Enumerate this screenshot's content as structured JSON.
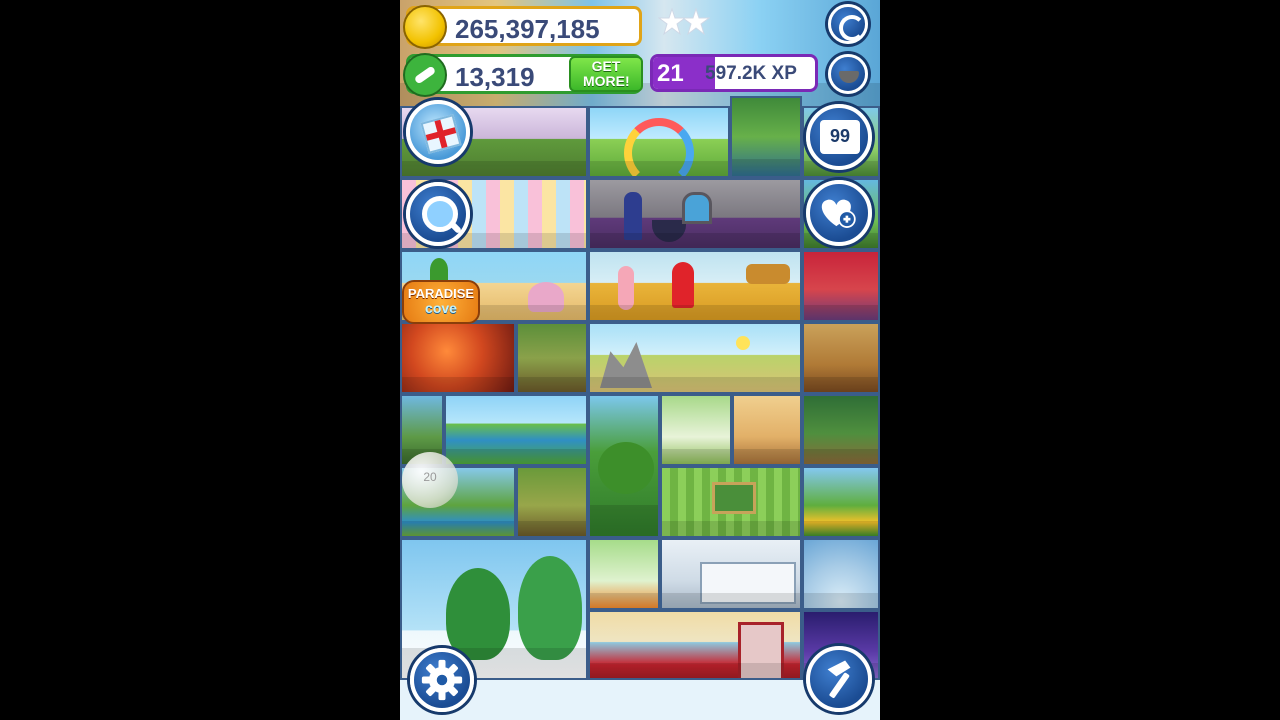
{
  "hud": {
    "coins": "265,397,185",
    "bones": "13,319",
    "get_more_label": "GET MORE!",
    "level": "21",
    "xp": "597.2K XP",
    "pet_book_count": "99",
    "paradise_cove_line1": "PARADISE",
    "paradise_cove_line2": "cove",
    "bubble_text": "20"
  },
  "icons": {
    "coin": "coin-icon",
    "bone": "bone-icon",
    "gift": "gift-icon",
    "search": "magnifier-icon",
    "book": "book-icon",
    "heart_plus": "heart-plus-icon",
    "settings": "gear-icon",
    "build": "hammer-icon",
    "social": "g-logo-icon",
    "food_bowl": "food-bowl-icon"
  },
  "colors": {
    "coin_gold": "#f2c200",
    "bone_green": "#3db43d",
    "xp_purple": "#8b2fc9",
    "button_blue": "#1f5aa6",
    "get_more_green": "#4ccf2f"
  }
}
